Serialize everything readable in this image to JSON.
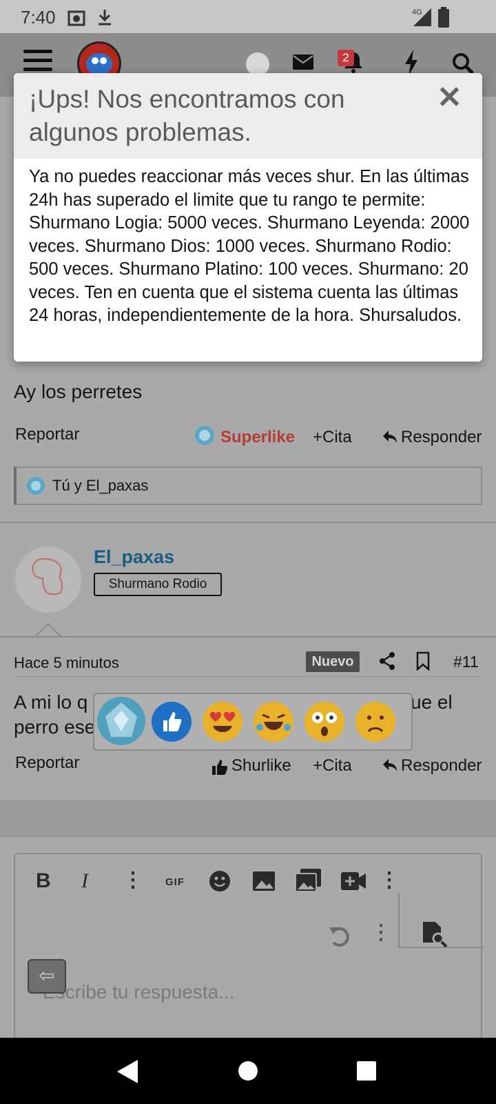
{
  "status_bar": {
    "time": "7:40",
    "network": "4G"
  },
  "header": {
    "notification_count": "2"
  },
  "post1": {
    "text": "Ay los perretes",
    "report_label": "Reportar",
    "superlike_label": "Superlike",
    "quote_label": "+Cita",
    "reply_label": "Responder",
    "reactions_summary": "Tú y El_paxas"
  },
  "post2": {
    "username": "El_paxas",
    "rank": "Shurmano Rodio",
    "time_ago": "Hace 5 minutos",
    "new_badge": "Nuevo",
    "post_number": "#11",
    "text_line1_start": "A mi lo q",
    "text_line1_end": "ue el",
    "text_line2": "perro ese",
    "report_label": "Reportar",
    "like_label": "Shurlike",
    "quote_label": "+Cita",
    "reply_label": "Responder"
  },
  "editor": {
    "placeholder": "Escribe tu respuesta...",
    "gif_label": "GIF"
  },
  "dialog": {
    "title": "¡Ups! Nos encontramos con algunos problemas.",
    "close_symbol": "✕",
    "message": "Ya no puedes reaccionar más veces shur. En las últimas 24h has superado el limite que tu rango te permite: Shurmano Logia: 5000 veces. Shurmano Leyenda: 2000 veces. Shurmano Dios: 1000 veces. Shurmano Rodio: 500 veces. Shurmano Platino: 100 veces. Shurmano: 20 veces. Ten en cuenta que el sistema cuenta las últimas 24 horas, independientemente de la hora. Shursaludos."
  },
  "colors": {
    "overlay_gray": "#a9a9a9",
    "superlike_red": "#b23e33",
    "username_blue": "#175f82"
  }
}
